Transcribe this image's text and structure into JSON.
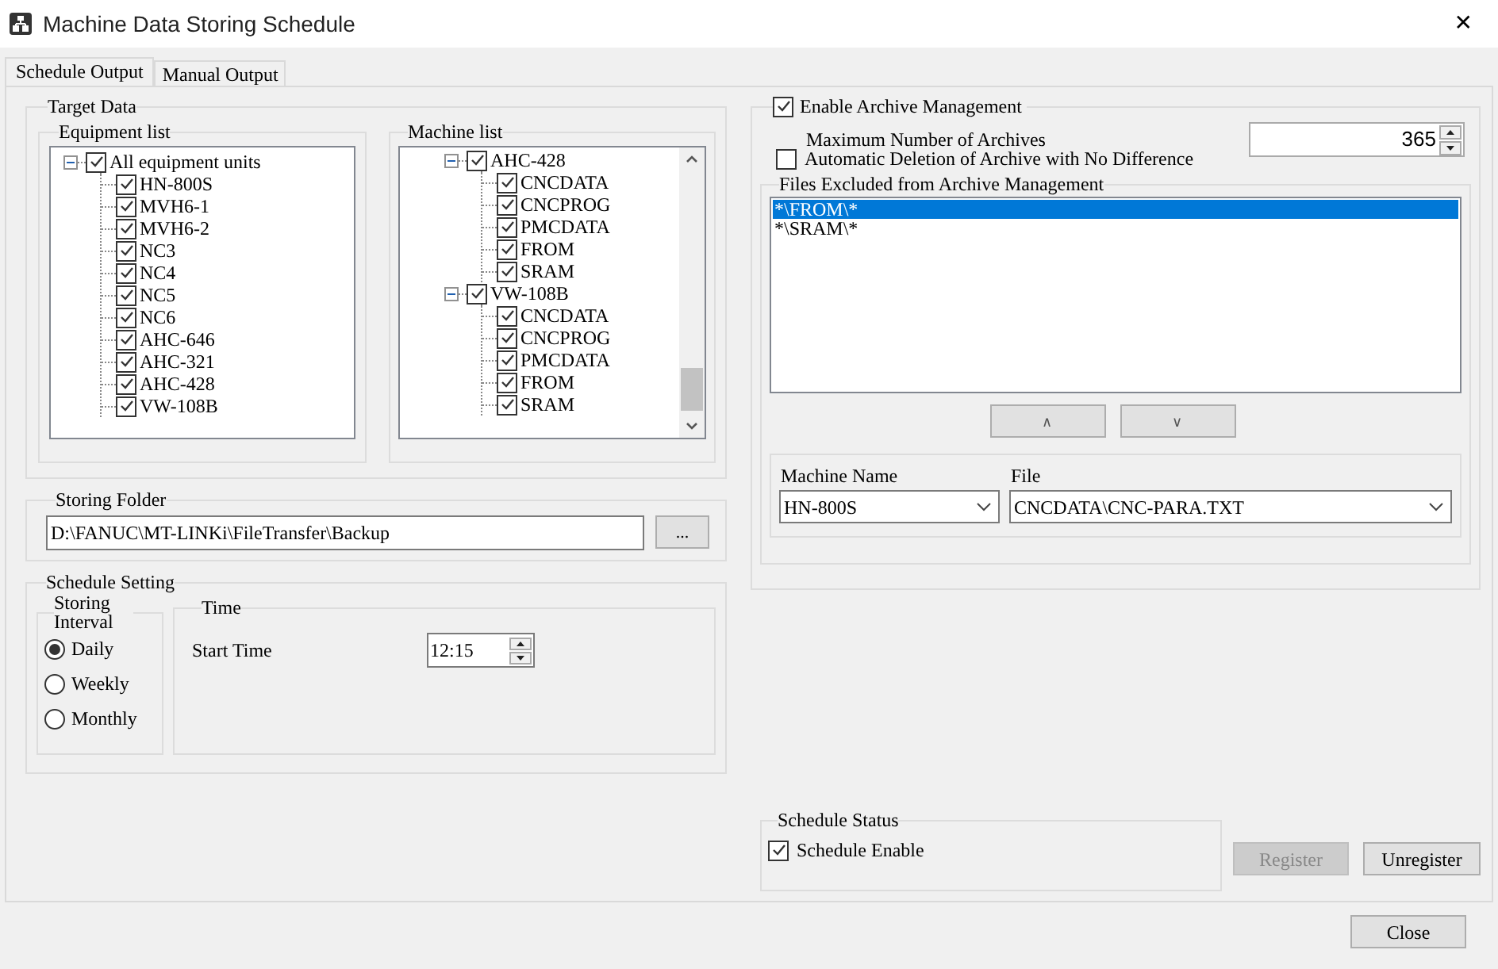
{
  "window": {
    "title": "Machine Data Storing Schedule",
    "close_glyph": "✕"
  },
  "tabs": [
    {
      "label": "Schedule Output",
      "selected": true
    },
    {
      "label": "Manual Output",
      "selected": false
    }
  ],
  "target_data": {
    "title": "Target Data",
    "equipment_list": {
      "title": "Equipment list",
      "items": [
        {
          "label": "All equipment units",
          "checked": true,
          "expanded": true,
          "children": [
            {
              "label": "HN-800S",
              "checked": true
            },
            {
              "label": "MVH6-1",
              "checked": true
            },
            {
              "label": "MVH6-2",
              "checked": true
            },
            {
              "label": "NC3",
              "checked": true
            },
            {
              "label": "NC4",
              "checked": true
            },
            {
              "label": "NC5",
              "checked": true
            },
            {
              "label": "NC6",
              "checked": true
            },
            {
              "label": "AHC-646",
              "checked": true
            },
            {
              "label": "AHC-321",
              "checked": true
            },
            {
              "label": "AHC-428",
              "checked": true
            },
            {
              "label": "VW-108B",
              "checked": true
            }
          ]
        }
      ]
    },
    "machine_list": {
      "title": "Machine list",
      "items": [
        {
          "label": "AHC-428",
          "checked": true,
          "expanded": true,
          "children": [
            {
              "label": "CNCDATA",
              "checked": true
            },
            {
              "label": "CNCPROG",
              "checked": true
            },
            {
              "label": "PMCDATA",
              "checked": true
            },
            {
              "label": "FROM",
              "checked": true
            },
            {
              "label": "SRAM",
              "checked": true
            }
          ]
        },
        {
          "label": "VW-108B",
          "checked": true,
          "expanded": true,
          "children": [
            {
              "label": "CNCDATA",
              "checked": true
            },
            {
              "label": "CNCPROG",
              "checked": true
            },
            {
              "label": "PMCDATA",
              "checked": true
            },
            {
              "label": "FROM",
              "checked": true
            },
            {
              "label": "SRAM",
              "checked": true
            }
          ]
        }
      ]
    }
  },
  "storing_folder": {
    "title": "Storing Folder",
    "value": "D:\\FANUC\\MT-LINKi\\FileTransfer\\Backup",
    "browse_label": "..."
  },
  "schedule_setting": {
    "title": "Schedule Setting",
    "interval": {
      "title": "Storing Interval",
      "options": [
        {
          "label": "Daily",
          "selected": true
        },
        {
          "label": "Weekly",
          "selected": false
        },
        {
          "label": "Monthly",
          "selected": false
        }
      ]
    },
    "time": {
      "title": "Time",
      "start_time_label": "Start Time",
      "start_time": "12:15"
    }
  },
  "archive": {
    "label": "Enable Archive Management",
    "checked": true,
    "max_label": "Maximum Number of Archives",
    "max_value": "365",
    "auto_delete": {
      "label": "Automatic Deletion of Archive with No Difference",
      "checked": false
    },
    "excluded": {
      "title": "Files Excluded from Archive Management",
      "items": [
        {
          "label": "*\\FROM\\*",
          "selected": true
        },
        {
          "label": "*\\SRAM\\*",
          "selected": false
        }
      ],
      "up_label": "∧",
      "down_label": "∨"
    },
    "machine_name": {
      "label": "Machine Name",
      "value": "HN-800S"
    },
    "file": {
      "label": "File",
      "value": "CNCDATA\\CNC-PARA.TXT"
    }
  },
  "schedule_status": {
    "title": "Schedule Status",
    "enable": {
      "label": "Schedule Enable",
      "checked": true
    }
  },
  "buttons": [
    {
      "label": "Register",
      "disabled": true
    },
    {
      "label": "Unregister",
      "disabled": false
    }
  ],
  "close_button": "Close"
}
